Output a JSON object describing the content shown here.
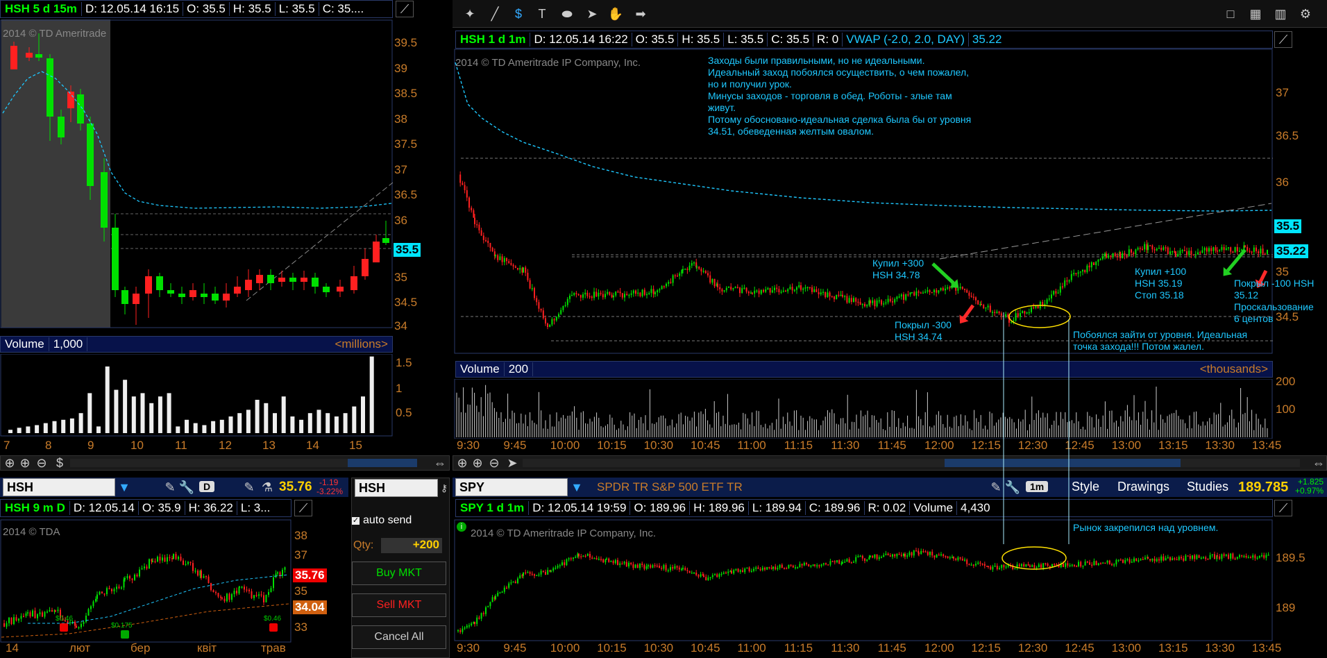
{
  "topleft": {
    "symbol": "HSH 5 d 15m",
    "fields": [
      "D: 12.05.14 16:15",
      "O: 35.5",
      "H: 35.5",
      "L: 35.5",
      "C: 35...."
    ],
    "copyright": "2014 © TD Ameritrade",
    "price_axis": [
      "39.5",
      "39",
      "38.5",
      "38",
      "37.5",
      "37",
      "36.5",
      "36",
      "35.5",
      "35",
      "34.5",
      "34"
    ],
    "last_price": "35.5",
    "volume_label": "Volume",
    "volume_value": "1,000",
    "volume_unit": "<millions>",
    "volume_axis": [
      "1.5",
      "1",
      "0.5"
    ],
    "time_axis": [
      "7",
      "8",
      "9",
      "10",
      "11",
      "12",
      "13",
      "14",
      "15"
    ]
  },
  "toolbar": {
    "right_icons": [
      "single-layout-icon",
      "grid-layout-icon",
      "multi-layout-icon",
      "gear-icon"
    ]
  },
  "main": {
    "symbol": "HSH 1 d 1m",
    "fields": [
      "D: 12.05.14 16:22",
      "O: 35.5",
      "H: 35.5",
      "L: 35.5",
      "C: 35.5",
      "R: 0"
    ],
    "vwap": "VWAP (-2.0, 2.0, DAY)",
    "vwap_value": "35.22",
    "copyright": "2014 © TD Ameritrade IP Company, Inc.",
    "price_axis": [
      "37",
      "36.5",
      "36",
      "35",
      "34.5"
    ],
    "last_price": "35.5",
    "vwap_tag": "35.22",
    "note_main": "Заходы были правильными, но не идеальными.\nИдеальный заход побоялся осуществить, о чем пожалел,\nно и получил урок.\nМинусы заходов - торговля в обед. Роботы - злые там\nживут.\nПотому обосновано-идеальная сделка была бы от уровня\n34.51, обеведенная желтым овалом.",
    "note_buy1": "Купил +300\nHSH 34.78",
    "note_sell1": "Покрыл -300\nHSH 34.74",
    "note_buy2": "Купил +100\nHSH 35.19\nСтоп 35.18",
    "note_sell2": "Покрыл -100 HSH\n35.12\nПроскальзование\n6 центов",
    "note_fear": "Побоялся зайти от уровня. Идеальная\nточка захода!!! Потом жалел.",
    "volume_label": "Volume",
    "volume_value": "200",
    "volume_unit": "<thousands>",
    "volume_axis": [
      "200",
      "100"
    ],
    "time_axis": [
      "9:30",
      "9:45",
      "10:00",
      "10:15",
      "10:30",
      "10:45",
      "11:00",
      "11:15",
      "11:30",
      "11:45",
      "12:00",
      "12:15",
      "12:30",
      "12:45",
      "13:00",
      "13:15",
      "13:30",
      "13:45"
    ]
  },
  "bottomleft": {
    "symbol_input": "HSH",
    "interval": "D",
    "last": "35.76",
    "change": "-1.19",
    "change_pct": "-3.22%",
    "title": "HSH 9 m D",
    "fields": [
      "D: 12.05.14",
      "O: 35.9",
      "H: 36.22",
      "L: 3..."
    ],
    "copyright": "2014 © TDA",
    "price_axis": [
      "38",
      "37",
      "36",
      "35",
      "34",
      "33"
    ],
    "price_tag1": "35.76",
    "price_tag2": "34.04",
    "time_axis": [
      "14",
      "лют",
      "бер",
      "квіт",
      "трав"
    ],
    "div_labels": [
      "$0.46",
      "$0.175",
      "$0.46"
    ]
  },
  "order": {
    "symbol_input": "HSH",
    "auto_send": "auto send",
    "qty_label": "Qty:",
    "qty_value": "+200",
    "buy": "Buy MKT",
    "sell": "Sell MKT",
    "cancel": "Cancel All"
  },
  "spy": {
    "symbol_input": "SPY",
    "description": "SPDR TR S&P 500 ETF TR",
    "interval": "1m",
    "style": "Style",
    "drawings": "Drawings",
    "studies": "Studies",
    "last": "189.785",
    "change": "+1.825",
    "change_pct": "+0.97%",
    "title": "SPY 1 d 1m",
    "fields": [
      "D: 12.05.14 19:59",
      "O: 189.96",
      "H: 189.96",
      "L: 189.94",
      "C: 189.96",
      "R: 0.02",
      "Volume",
      "4,430"
    ],
    "copyright": "2014 © TD Ameritrade IP Company, Inc.",
    "note": "Рынок закрепился над уровнем.",
    "price_axis": [
      "189.5",
      "189"
    ],
    "time_axis": [
      "9:30",
      "9:45",
      "10:00",
      "10:15",
      "10:30",
      "10:45",
      "11:00",
      "11:15",
      "11:30",
      "11:45",
      "12:00",
      "12:15",
      "12:30",
      "12:45",
      "13:00",
      "13:15",
      "13:30",
      "13:45"
    ]
  },
  "colors": {
    "up": "#00e000",
    "down": "#ff2020",
    "accent": "#1ec8ff",
    "axis": "#c97c2a"
  }
}
